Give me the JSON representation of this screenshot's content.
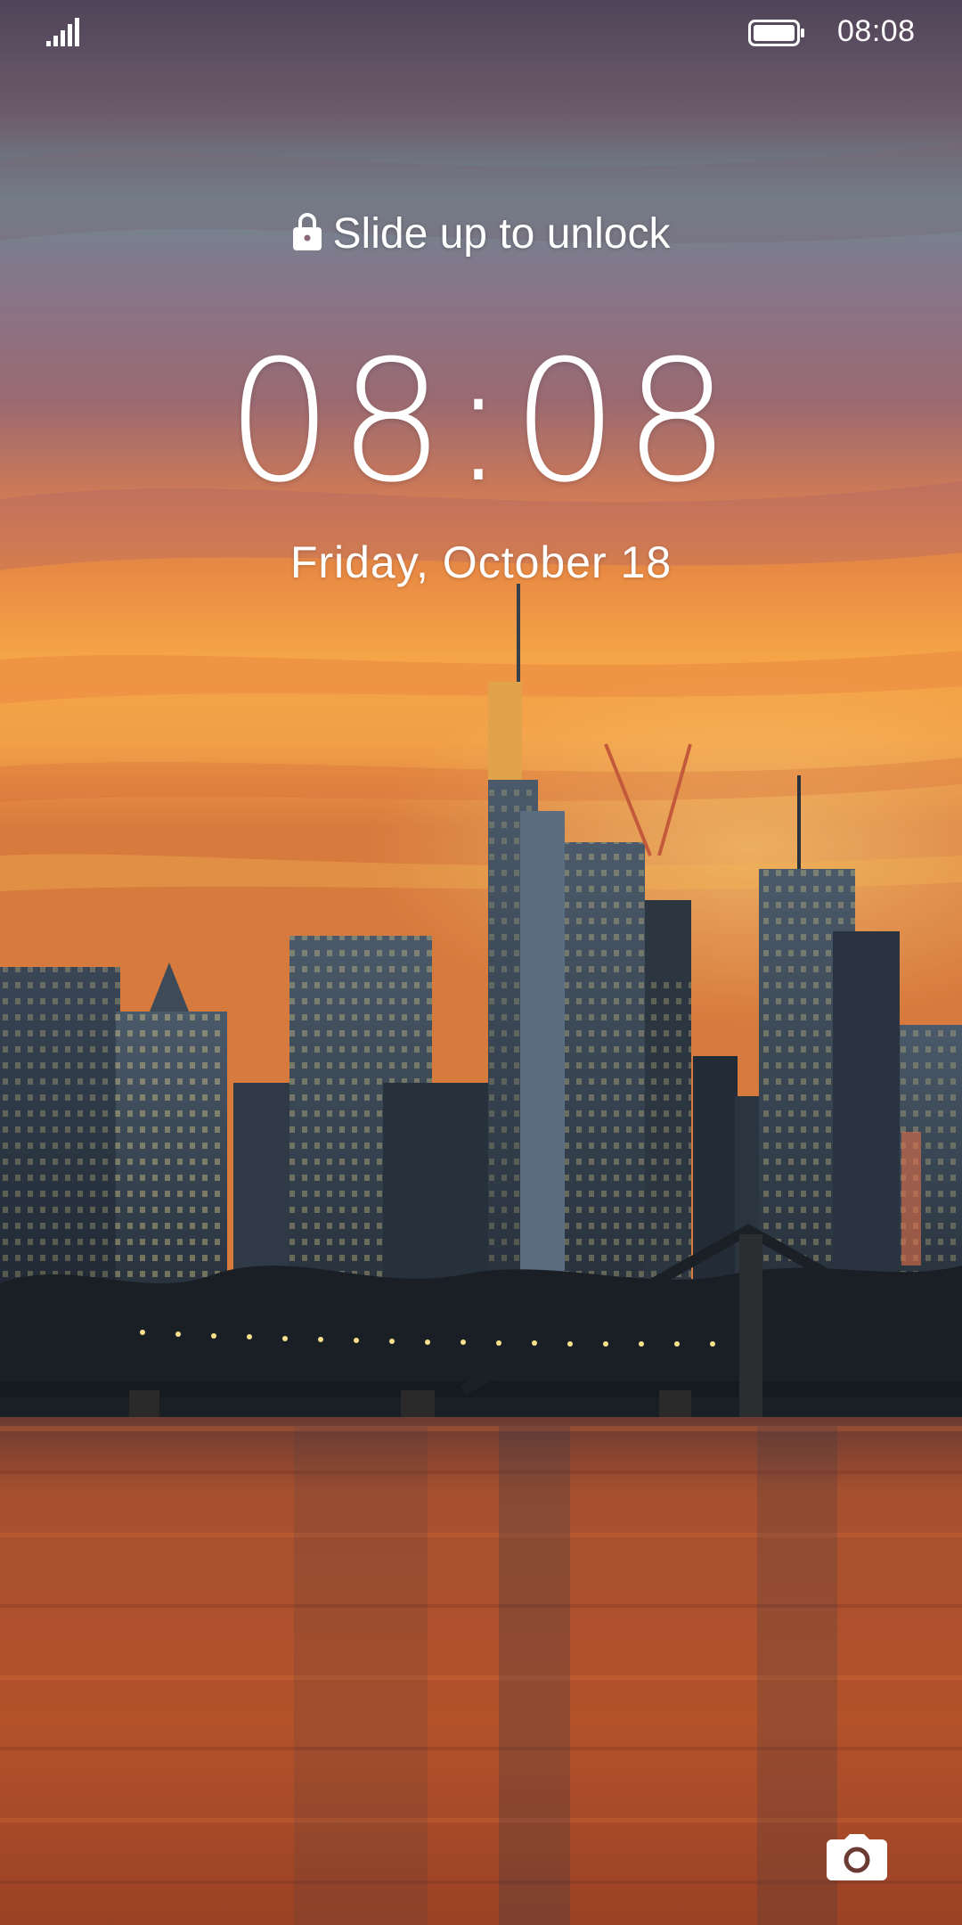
{
  "status_bar": {
    "signal_icon": "signal-bars-icon",
    "battery_icon": "battery-full-icon",
    "time": "08:08"
  },
  "lock_screen": {
    "unlock_hint": "Slide up to unlock",
    "lock_icon": "lock-icon",
    "clock": "08:08",
    "date": "Friday, October 18",
    "camera_icon": "camera-icon"
  },
  "wallpaper": {
    "description_colors": {
      "sky_top": "#5b4a63",
      "sky_mid": "#8a6a7a",
      "sunset_orange": "#f08a3a",
      "sunset_yellow": "#f7b24a",
      "water": "#a2452a"
    }
  }
}
